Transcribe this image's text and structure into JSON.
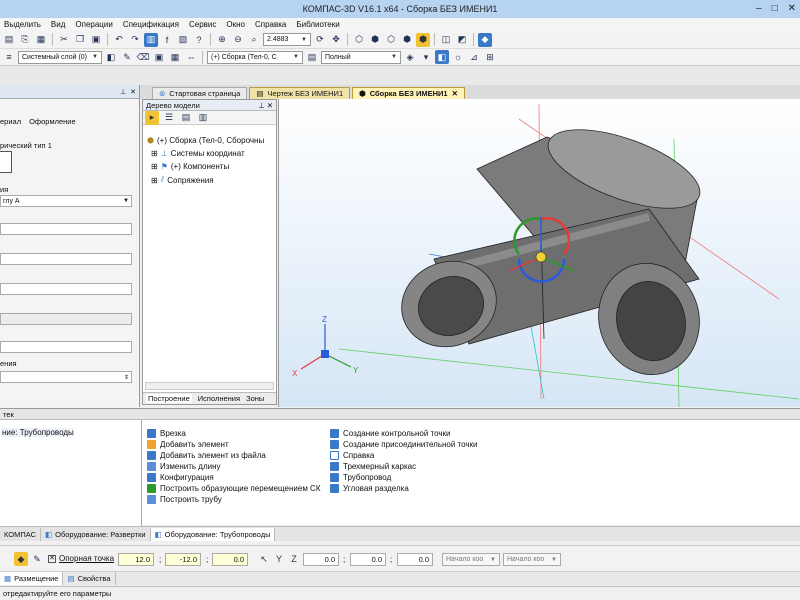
{
  "window": {
    "title": "КОМПАС-3D V16.1 x64 - Сборка БЕЗ ИМЕНИ1"
  },
  "menu": [
    "Выделить",
    "Вид",
    "Операции",
    "Спецификация",
    "Сервис",
    "Окно",
    "Справка",
    "Библиотеки"
  ],
  "toolbar": {
    "zoom_value": "2.4883"
  },
  "toolbar2": {
    "layer_combo": "Системный слой (0)",
    "assembly_combo": "(+) Сборка (Тел-0, С",
    "display_combo": "Полный"
  },
  "doc_tabs": [
    "Стартовая страница",
    "Чертеж БЕЗ ИМЕНИ1",
    "Сборка БЕЗ ИМЕНИ1"
  ],
  "left_panel": {
    "tabs": [
      "ериал",
      "Оформление"
    ],
    "type_label": "рический тип 1",
    "label_1": "ия",
    "combo_1": "глу А",
    "label_2": "ения"
  },
  "tree": {
    "title": "Дерево модели",
    "root": "(+) Сборка (Тел-0, Сборочны",
    "items": [
      "Системы координат",
      "(+) Компоненты",
      "Сопряжения"
    ],
    "bottom_tabs": [
      "Построение",
      "Исполнения",
      "Зоны"
    ]
  },
  "viewport": {
    "axis_x": "X",
    "axis_y": "Y",
    "axis_z": "Z"
  },
  "bottom_panel": {
    "title": "тек",
    "library": "ние: Трубопроводы",
    "commands_col1": [
      "Врезка",
      "Добавить элемент",
      "Добавить элемент из файла",
      "Изменить длину",
      "Конфигурация",
      "Построить образующие перемещением СК",
      "Построить трубу"
    ],
    "commands_col2": [
      "Создание контрольной точки",
      "Создание присоединительной точки",
      "Справка",
      "Трехмерный каркас",
      "Трубопровод",
      "Угловая разделка"
    ]
  },
  "lib_tabs": [
    "КОМПАС",
    "Оборудование: Развертки",
    "Оборудование: Трубопроводы"
  ],
  "propbar": {
    "point_label": "Опорная точка",
    "x1": "12.0",
    "y1": "-12.0",
    "z1": "0.0",
    "x2": "0.0",
    "y2": "0.0",
    "z2": "0.0",
    "combo1": "Начало коо",
    "combo2": "Начало коо"
  },
  "prop_tabs": [
    "Размещение",
    "Свойства"
  ],
  "status": "отредактируйте его параметры",
  "colors": {
    "accent": "#3a78c8",
    "tab_active": "#fff3b8",
    "pipe": "#8a8a8a"
  }
}
